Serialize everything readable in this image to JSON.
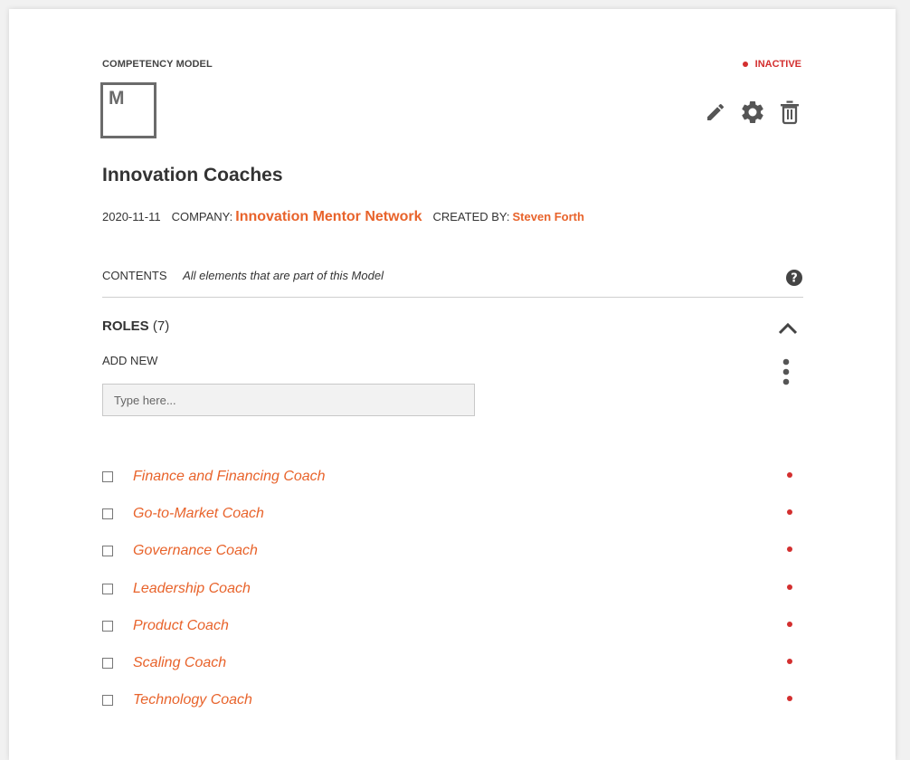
{
  "model": {
    "type_label": "COMPETENCY MODEL",
    "status": "INACTIVE",
    "icon_letter": "M",
    "title": "Innovation Coaches",
    "date": "2020-11-11",
    "company_label": "COMPANY:",
    "company": "Innovation Mentor Network",
    "created_by_label": "CREATED BY:",
    "created_by": "Steven Forth"
  },
  "actions": {
    "edit_icon": "pencil-icon",
    "settings_icon": "gear-icon",
    "delete_icon": "trash-icon"
  },
  "contents": {
    "label": "CONTENTS",
    "description": "All elements that are part of this Model",
    "help_icon": "question-circle-icon"
  },
  "roles": {
    "heading": "ROLES",
    "count": "(7)",
    "add_new_label": "ADD NEW",
    "input_placeholder": "Type here...",
    "items": [
      {
        "label": "Finance and Financing Coach"
      },
      {
        "label": "Go-to-Market Coach"
      },
      {
        "label": "Governance Coach"
      },
      {
        "label": "Leadership Coach"
      },
      {
        "label": "Product Coach"
      },
      {
        "label": "Scaling Coach"
      },
      {
        "label": "Technology Coach"
      }
    ]
  },
  "colors": {
    "accent": "#e8632b",
    "inactive": "#d32f2f",
    "icon_gray": "#555555"
  }
}
